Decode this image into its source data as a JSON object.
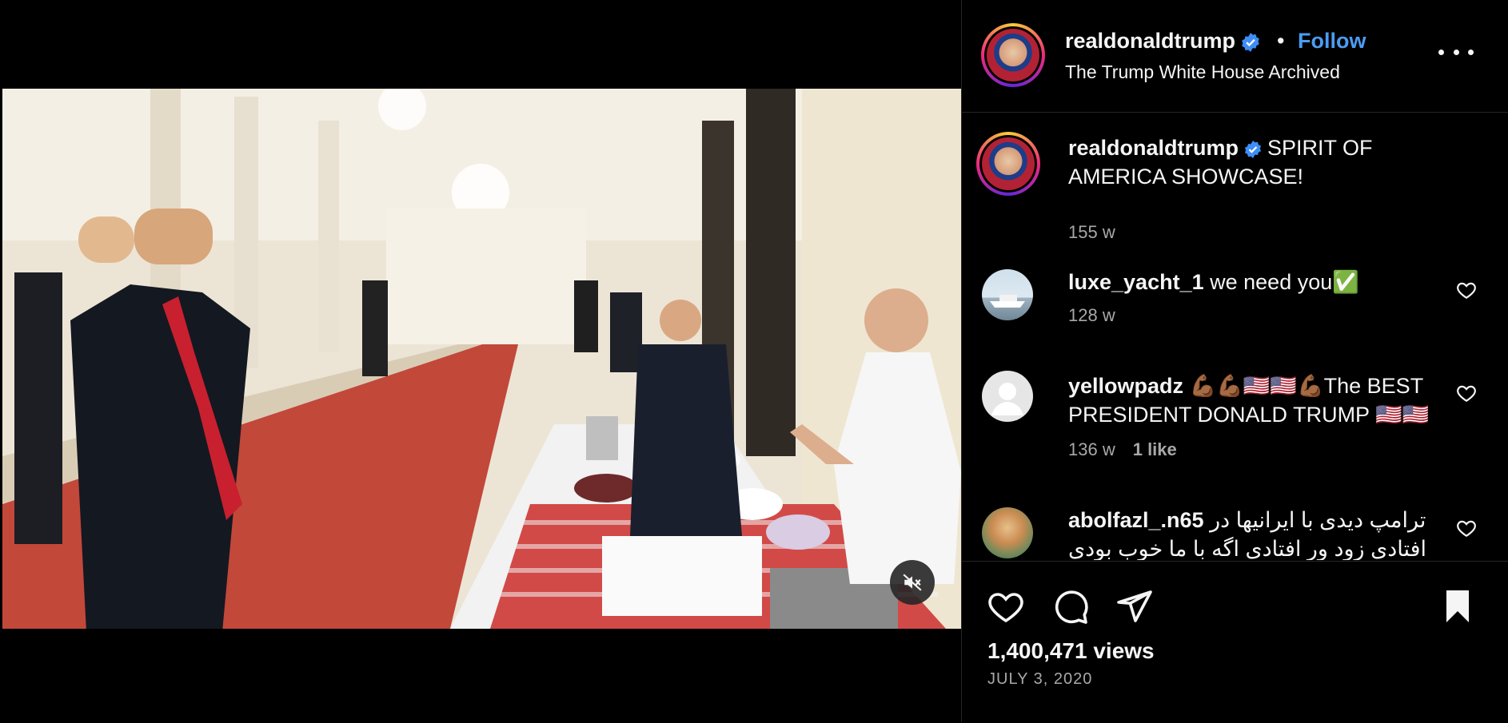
{
  "header": {
    "username": "realdonaldtrump",
    "separator": "•",
    "follow_label": "Follow",
    "subtitle": "The Trump White House Archived"
  },
  "caption": {
    "username": "realdonaldtrump",
    "text": "SPIRIT OF AMERICA SHOWCASE!",
    "age": "155 w"
  },
  "comments": [
    {
      "username": "luxe_yacht_1",
      "text": "we need you✅",
      "age": "128 w",
      "likes": ""
    },
    {
      "username": "yellowpadz",
      "text": "💪🏾💪🏾🇺🇸🇺🇸💪🏾The BEST PRESIDENT DONALD TRUMP 🇺🇸🇺🇸",
      "age": "136 w",
      "likes": "1 like"
    },
    {
      "username": "abolfazl_.n65",
      "text": "ترامپ دیدی با ایرانیها در افتادی زود ور افتادی اگه با ما خوب بودی الان به",
      "age": "",
      "likes": ""
    }
  ],
  "stats": {
    "views": "1,400,471 views",
    "date": "JULY 3, 2020"
  },
  "icons": {
    "verified": "verified-badge-icon",
    "more": "more-options-icon",
    "like": "heart-icon",
    "comment": "comment-icon",
    "share": "share-icon",
    "save": "bookmark-icon",
    "mute": "muted-speaker-icon"
  },
  "colors": {
    "background": "#000000",
    "link_blue": "#4a9cf5",
    "muted_text": "#a8a8a8",
    "divider": "#262626"
  }
}
